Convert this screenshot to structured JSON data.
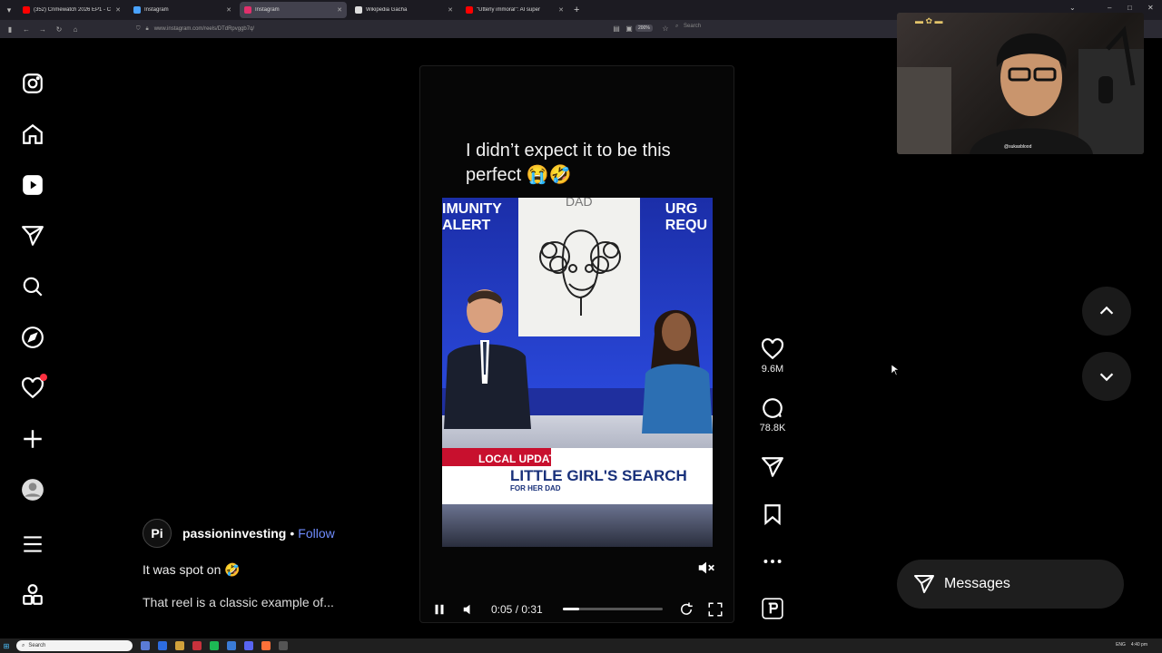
{
  "browser": {
    "tabs": [
      {
        "title": "(352) Crimewatch 2026 EP1 - C",
        "favicon_color": "#ff0000"
      },
      {
        "title": "Instagram",
        "favicon_color": "#4aa3ff"
      },
      {
        "title": "Instagram",
        "favicon_color": "#e1306c",
        "active": true
      },
      {
        "title": "Wikipedia Gacha",
        "favicon_color": "#dddddd"
      },
      {
        "title": "\"Utterly immoral\": AI super",
        "favicon_color": "#ff0000"
      }
    ],
    "url": "www.instagram.com/reels/DTdRpvggb7q/",
    "zoom": "200%",
    "search_placeholder": "Search"
  },
  "reel": {
    "caption_overlay": "I didn’t expect it to be this perfect 😭🤣",
    "news": {
      "alert_left": "IMUNITY\nALERT",
      "alert_right": "URG\nREQU",
      "drawing_label": "DAD",
      "lower_tag": "LOCAL UPDATE",
      "headline": "LITTLE GIRL'S SEARCH",
      "subheadline": "FOR HER DAD"
    },
    "time": "0:05 / 0:31",
    "progress_fraction": 0.16
  },
  "actions": {
    "likes": "9.6M",
    "comments": "78.8K"
  },
  "author": {
    "username": "passioninvesting",
    "separator": "•",
    "follow": "Follow",
    "caption": "It was spot on 🤣",
    "comment_preview": "That reel is a classic example of..."
  },
  "messages": {
    "label": "Messages"
  },
  "webcam": {
    "handle": "@sukasblood"
  },
  "taskbar": {
    "search": "Search",
    "lang": "ENG",
    "time": "4:40 pm"
  }
}
